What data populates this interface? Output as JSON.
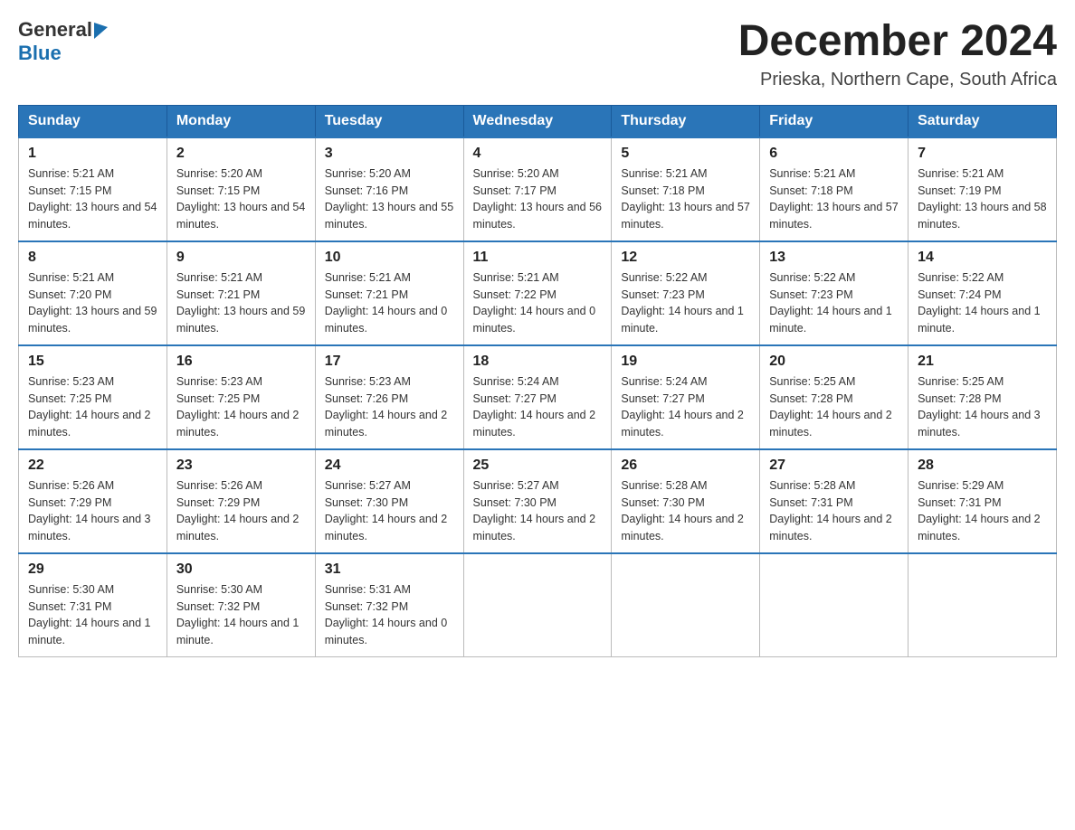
{
  "header": {
    "logo_general": "General",
    "logo_blue": "Blue",
    "title": "December 2024",
    "subtitle": "Prieska, Northern Cape, South Africa"
  },
  "weekdays": [
    "Sunday",
    "Monday",
    "Tuesday",
    "Wednesday",
    "Thursday",
    "Friday",
    "Saturday"
  ],
  "weeks": [
    [
      {
        "day": "1",
        "sunrise": "5:21 AM",
        "sunset": "7:15 PM",
        "daylight": "13 hours and 54 minutes."
      },
      {
        "day": "2",
        "sunrise": "5:20 AM",
        "sunset": "7:15 PM",
        "daylight": "13 hours and 54 minutes."
      },
      {
        "day": "3",
        "sunrise": "5:20 AM",
        "sunset": "7:16 PM",
        "daylight": "13 hours and 55 minutes."
      },
      {
        "day": "4",
        "sunrise": "5:20 AM",
        "sunset": "7:17 PM",
        "daylight": "13 hours and 56 minutes."
      },
      {
        "day": "5",
        "sunrise": "5:21 AM",
        "sunset": "7:18 PM",
        "daylight": "13 hours and 57 minutes."
      },
      {
        "day": "6",
        "sunrise": "5:21 AM",
        "sunset": "7:18 PM",
        "daylight": "13 hours and 57 minutes."
      },
      {
        "day": "7",
        "sunrise": "5:21 AM",
        "sunset": "7:19 PM",
        "daylight": "13 hours and 58 minutes."
      }
    ],
    [
      {
        "day": "8",
        "sunrise": "5:21 AM",
        "sunset": "7:20 PM",
        "daylight": "13 hours and 59 minutes."
      },
      {
        "day": "9",
        "sunrise": "5:21 AM",
        "sunset": "7:21 PM",
        "daylight": "13 hours and 59 minutes."
      },
      {
        "day": "10",
        "sunrise": "5:21 AM",
        "sunset": "7:21 PM",
        "daylight": "14 hours and 0 minutes."
      },
      {
        "day": "11",
        "sunrise": "5:21 AM",
        "sunset": "7:22 PM",
        "daylight": "14 hours and 0 minutes."
      },
      {
        "day": "12",
        "sunrise": "5:22 AM",
        "sunset": "7:23 PM",
        "daylight": "14 hours and 1 minute."
      },
      {
        "day": "13",
        "sunrise": "5:22 AM",
        "sunset": "7:23 PM",
        "daylight": "14 hours and 1 minute."
      },
      {
        "day": "14",
        "sunrise": "5:22 AM",
        "sunset": "7:24 PM",
        "daylight": "14 hours and 1 minute."
      }
    ],
    [
      {
        "day": "15",
        "sunrise": "5:23 AM",
        "sunset": "7:25 PM",
        "daylight": "14 hours and 2 minutes."
      },
      {
        "day": "16",
        "sunrise": "5:23 AM",
        "sunset": "7:25 PM",
        "daylight": "14 hours and 2 minutes."
      },
      {
        "day": "17",
        "sunrise": "5:23 AM",
        "sunset": "7:26 PM",
        "daylight": "14 hours and 2 minutes."
      },
      {
        "day": "18",
        "sunrise": "5:24 AM",
        "sunset": "7:27 PM",
        "daylight": "14 hours and 2 minutes."
      },
      {
        "day": "19",
        "sunrise": "5:24 AM",
        "sunset": "7:27 PM",
        "daylight": "14 hours and 2 minutes."
      },
      {
        "day": "20",
        "sunrise": "5:25 AM",
        "sunset": "7:28 PM",
        "daylight": "14 hours and 2 minutes."
      },
      {
        "day": "21",
        "sunrise": "5:25 AM",
        "sunset": "7:28 PM",
        "daylight": "14 hours and 3 minutes."
      }
    ],
    [
      {
        "day": "22",
        "sunrise": "5:26 AM",
        "sunset": "7:29 PM",
        "daylight": "14 hours and 3 minutes."
      },
      {
        "day": "23",
        "sunrise": "5:26 AM",
        "sunset": "7:29 PM",
        "daylight": "14 hours and 2 minutes."
      },
      {
        "day": "24",
        "sunrise": "5:27 AM",
        "sunset": "7:30 PM",
        "daylight": "14 hours and 2 minutes."
      },
      {
        "day": "25",
        "sunrise": "5:27 AM",
        "sunset": "7:30 PM",
        "daylight": "14 hours and 2 minutes."
      },
      {
        "day": "26",
        "sunrise": "5:28 AM",
        "sunset": "7:30 PM",
        "daylight": "14 hours and 2 minutes."
      },
      {
        "day": "27",
        "sunrise": "5:28 AM",
        "sunset": "7:31 PM",
        "daylight": "14 hours and 2 minutes."
      },
      {
        "day": "28",
        "sunrise": "5:29 AM",
        "sunset": "7:31 PM",
        "daylight": "14 hours and 2 minutes."
      }
    ],
    [
      {
        "day": "29",
        "sunrise": "5:30 AM",
        "sunset": "7:31 PM",
        "daylight": "14 hours and 1 minute."
      },
      {
        "day": "30",
        "sunrise": "5:30 AM",
        "sunset": "7:32 PM",
        "daylight": "14 hours and 1 minute."
      },
      {
        "day": "31",
        "sunrise": "5:31 AM",
        "sunset": "7:32 PM",
        "daylight": "14 hours and 0 minutes."
      },
      null,
      null,
      null,
      null
    ]
  ]
}
